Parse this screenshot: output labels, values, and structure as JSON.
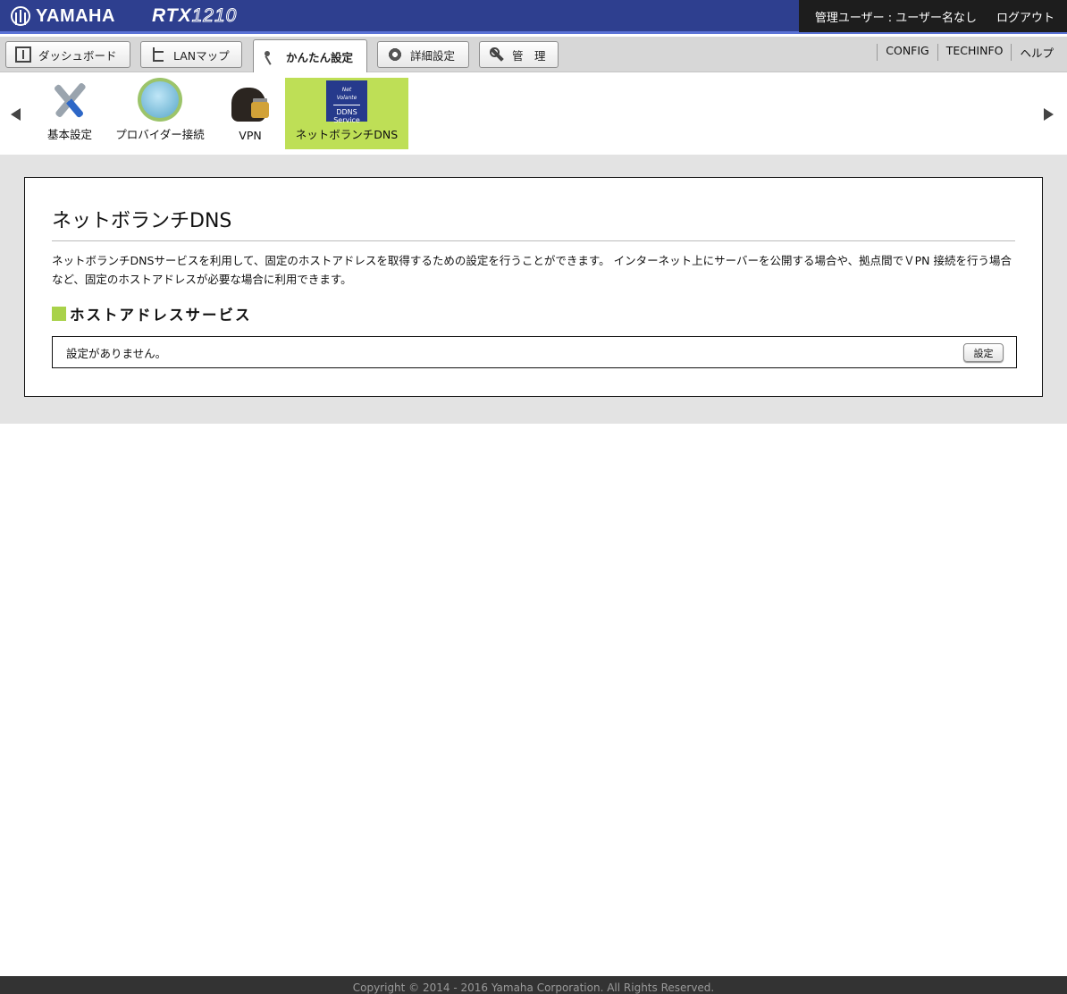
{
  "header": {
    "brand": "YAMAHA",
    "model_prefix": "RTX",
    "model_number": "1210",
    "user_label": "管理ユーザー : ユーザー名なし",
    "logout_label": "ログアウト"
  },
  "tabs": [
    {
      "label": "ダッシュボード",
      "icon": "dashboard-icon"
    },
    {
      "label": "LANマップ",
      "icon": "lan-map-icon"
    },
    {
      "label": "かんたん設定",
      "icon": "wand-icon",
      "active": true
    },
    {
      "label": "詳細設定",
      "icon": "gear-icon"
    },
    {
      "label": "管　理",
      "icon": "wrench-icon"
    }
  ],
  "right_links": [
    "CONFIG",
    "TECHINFO",
    "ヘルプ"
  ],
  "icon_strip": [
    {
      "label": "基本設定",
      "icon": "tools-icon"
    },
    {
      "label": "プロバイダー接続",
      "icon": "globe-icon"
    },
    {
      "label": "VPN",
      "icon": "vpn-lock-icon"
    },
    {
      "label": "ネットボランチDNS",
      "icon": "ddns-service-icon",
      "active": true,
      "icon_text": [
        "Net",
        "Volante",
        "DDNS",
        "Service"
      ]
    }
  ],
  "page": {
    "title": "ネットボランチDNS",
    "description": "ネットボランチDNSサービスを利用して、固定のホストアドレスを取得するための設定を行うことができます。 インターネット上にサーバーを公開する場合や、拠点間でＶPN 接続を行う場合など、固定のホストアドレスが必要な場合に利用できます。",
    "section_title": "ホストアドレスサービス",
    "empty_message": "設定がありません。",
    "config_button": "設定"
  },
  "footer": {
    "copyright": "Copyright © 2014 - 2016 Yamaha Corporation. All Rights Reserved."
  },
  "colors": {
    "header_bg": "#2e3f8f",
    "active_green": "#bedf56",
    "section_square": "#a9d24a",
    "footer_bg": "#333333"
  }
}
